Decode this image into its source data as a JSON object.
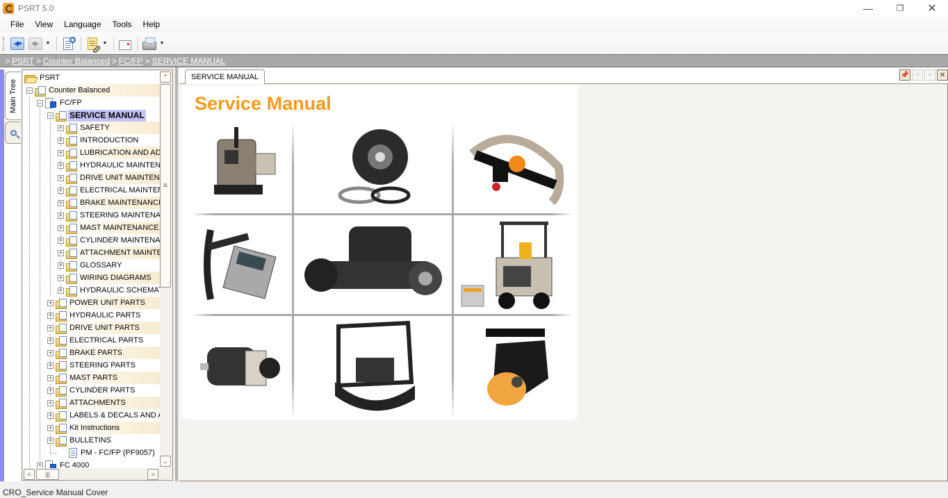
{
  "window": {
    "title": "PSRT 5.0",
    "controls": [
      "minimize",
      "restore",
      "close"
    ]
  },
  "menu": [
    "File",
    "View",
    "Language",
    "Tools",
    "Help"
  ],
  "toolbar": {
    "buttons": [
      {
        "name": "back",
        "icon": "back-arrow-icon"
      },
      {
        "name": "forward",
        "icon": "forward-arrow-icon",
        "has_dropdown": true
      },
      {
        "name": "search-document",
        "icon": "document-search-icon"
      },
      {
        "name": "notes-link",
        "icon": "note-link-icon",
        "has_dropdown": true
      },
      {
        "name": "email",
        "icon": "email-document-icon"
      },
      {
        "name": "print",
        "icon": "printer-icon",
        "has_dropdown": true
      }
    ]
  },
  "breadcrumb": {
    "separator": ">",
    "items": [
      "PSRT",
      "Counter Balanced",
      "FC/FP",
      "SERVICE MANUAL"
    ]
  },
  "left_tabs": {
    "main_tree": "Main Tree",
    "search_icon": "search-icon"
  },
  "tree": {
    "root": "PSRT",
    "category": "Counter Balanced",
    "model": "FC/FP",
    "selected": "SERVICE MANUAL",
    "service_manual_children": [
      "SAFETY",
      "INTRODUCTION",
      "LUBRICATION AND ADJU",
      "HYDRAULIC MAINTENAN",
      "DRIVE UNIT MAINTENAN",
      "ELECTRICAL MAINTENAI",
      "BRAKE MAINTENANCE",
      "STEERING MAINTENANC",
      "MAST MAINTENANCE",
      "CYLINDER MAINTENANC",
      "ATTACHMENT MAINTENA",
      "GLOSSARY",
      "WIRING DIAGRAMS",
      "HYDRAULIC SCHEMATIC"
    ],
    "model_children": [
      "POWER UNIT PARTS",
      "HYDRAULIC PARTS",
      "DRIVE UNIT PARTS",
      "ELECTRICAL PARTS",
      "BRAKE PARTS",
      "STEERING PARTS",
      "MAST PARTS",
      "CYLINDER PARTS",
      "ATTACHMENTS",
      "LABELS & DECALS AND ACC",
      "Kit Instructions",
      "BULLETINS"
    ],
    "document_leaf": "PM - FC/FP (PF9057)",
    "next_model": "FC 4000"
  },
  "document": {
    "tab_label": "SERVICE MANUAL",
    "cover_title": "Service Manual",
    "title_color": "#f59a1b",
    "images": [
      "pallet-truck",
      "brake-assembly",
      "control-handle",
      "display-keypad",
      "drive-axle-motor",
      "counterbalanced-forklift",
      "electric-motor",
      "chassis-frame",
      "caster-wheel"
    ]
  },
  "status": {
    "text": "CRO_Service Manual Cover"
  },
  "colors": {
    "breadcrumb_bg": "#a9a9a9",
    "selection_bg": "#c3c3f6",
    "left_strip": "#8c8cf0",
    "accent_orange": "#f59a1b"
  }
}
